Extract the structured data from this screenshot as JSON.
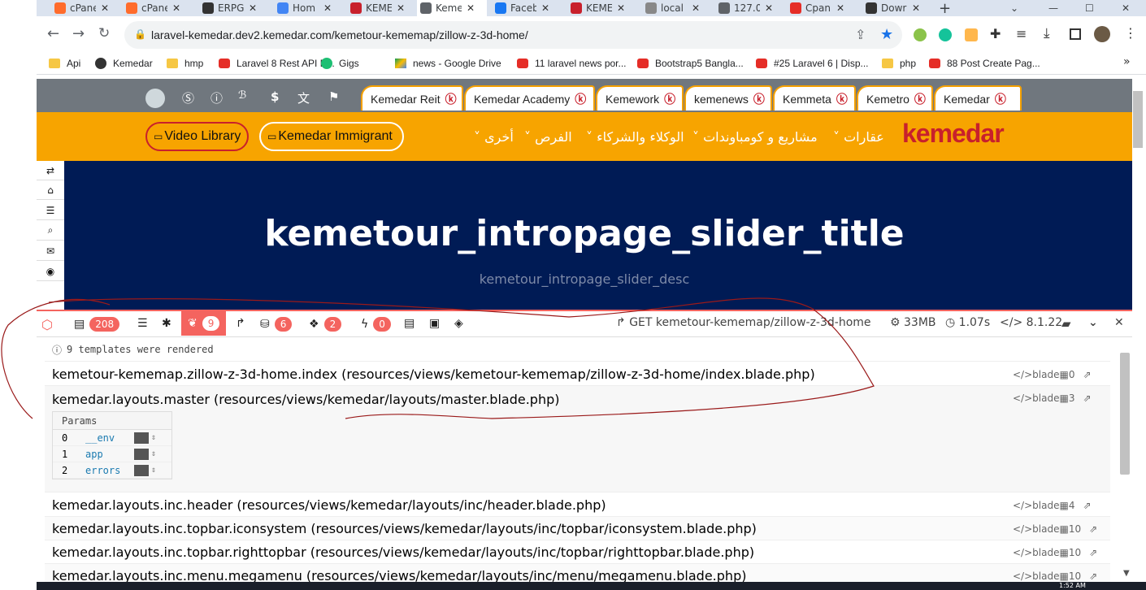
{
  "browser": {
    "tabs": [
      {
        "title": "cPane",
        "color": "#ff6c2c"
      },
      {
        "title": "cPane",
        "color": "#ff6c2c"
      },
      {
        "title": "ERPG",
        "color": "#333333"
      },
      {
        "title": "Hom",
        "color": "#4285f4"
      },
      {
        "title": "KEME",
        "color": "#c8202c"
      },
      {
        "title": "Keme",
        "color": "#5f6368"
      },
      {
        "title": "Faceb",
        "color": "#1877f2"
      },
      {
        "title": "KEME",
        "color": "#c8202c"
      },
      {
        "title": "local",
        "color": "#888888"
      },
      {
        "title": "127.0",
        "color": "#5f6368"
      },
      {
        "title": "Cpan",
        "color": "#e52d27"
      },
      {
        "title": "Dowr",
        "color": "#333333"
      }
    ],
    "tab_close": "✕",
    "new_tab": "+",
    "url": "laravel-kemedar.dev2.kemedar.com/kemetour-kememap/zillow-z-3d-home/",
    "bookmarks": [
      "Api",
      "Kemedar",
      "hmp",
      "Laravel 8 Rest API B...",
      "Gigs",
      "news - Google Drive",
      "11 laravel news por...",
      "Bootstrap5 Bangla...",
      "#25 Laravel 6 | Disp...",
      "php",
      "88 Post Create Pag..."
    ],
    "more": "»"
  },
  "site": {
    "portal_tabs": [
      "Kemedar Reit",
      "Kemedar Academy",
      "Kemework",
      "kemenews",
      "Kemmeta",
      "Kemetro",
      "Kemedar"
    ],
    "video_library": "Video Library",
    "immigrant": "Kemedar Immigrant",
    "menu": [
      "عقارات",
      "مشاريع و كومباوندات",
      "الوكلاء والشركاء",
      "الفرص",
      "أخرى"
    ],
    "logo": "kemedar",
    "hero_title": "kemetour_intropage_slider_title",
    "hero_desc": "kemetour_intropage_slider_desc"
  },
  "debugbar": {
    "counts": [
      "208",
      "9",
      "6",
      "2",
      "0"
    ],
    "route": "GET kemetour-kememap/zillow-z-3d-home",
    "memory": "33MB",
    "time": "1.07s",
    "php": "8.1.22",
    "summary": "9 templates were rendered",
    "templates": [
      {
        "name": "kemetour-kememap.zillow-z-3d-home.index (resources/views/kemetour-kememap/zillow-z-3d-home/index.blade.php)",
        "type": "blade",
        "params": "0"
      },
      {
        "name": "kemedar.layouts.master (resources/views/kemedar/layouts/master.blade.php)",
        "type": "blade",
        "params": "3"
      },
      {
        "name": "kemedar.layouts.inc.header (resources/views/kemedar/layouts/inc/header.blade.php)",
        "type": "blade",
        "params": "4"
      },
      {
        "name": "kemedar.layouts.inc.topbar.iconsystem (resources/views/kemedar/layouts/inc/topbar/iconsystem.blade.php)",
        "type": "blade",
        "params": "10"
      },
      {
        "name": "kemedar.layouts.inc.topbar.righttopbar (resources/views/kemedar/layouts/inc/topbar/righttopbar.blade.php)",
        "type": "blade",
        "params": "10"
      },
      {
        "name": "kemedar.layouts.inc.menu.megamenu (resources/views/kemedar/layouts/inc/menu/megamenu.blade.php)",
        "type": "blade",
        "params": "10"
      }
    ],
    "params_header": "Params",
    "params": [
      {
        "i": "0",
        "n": "__env"
      },
      {
        "i": "1",
        "n": "app"
      },
      {
        "i": "2",
        "n": "errors"
      }
    ]
  },
  "taskbar_time": "1:52 AM",
  "accent": "#f4645f",
  "site_orange": "#f7a400",
  "hero_bg": "#001b55"
}
